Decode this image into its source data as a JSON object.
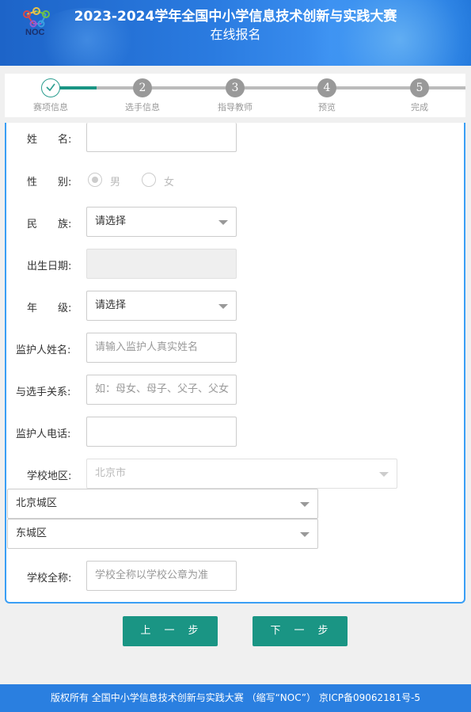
{
  "header": {
    "title_line1": "2023-2024学年全国中小学信息技术创新与实践大赛",
    "title_line2": "在线报名",
    "logo_text": "NOC"
  },
  "steps": [
    {
      "number": "1",
      "label": "赛项信息",
      "state": "done"
    },
    {
      "number": "2",
      "label": "选手信息",
      "state": "pending"
    },
    {
      "number": "3",
      "label": "指导教师",
      "state": "pending"
    },
    {
      "number": "4",
      "label": "预览",
      "state": "pending"
    },
    {
      "number": "5",
      "label": "完成",
      "state": "pending"
    }
  ],
  "form": {
    "name": {
      "label": "姓　　名:",
      "value": ""
    },
    "gender": {
      "label": "性　　别:",
      "options": [
        "男",
        "女"
      ],
      "selected": "男"
    },
    "ethnicity": {
      "label": "民　　族:",
      "value": "请选择"
    },
    "birthdate": {
      "label": "出生日期:",
      "value": ""
    },
    "grade": {
      "label": "年　　级:",
      "value": "请选择"
    },
    "guardian_name": {
      "label": "监护人姓名:",
      "placeholder": "请输入监护人真实姓名"
    },
    "relationship": {
      "label": "与选手关系:",
      "placeholder": "如：母女、母子、父子、父女"
    },
    "guardian_phone": {
      "label": "监护人电话:",
      "value": ""
    },
    "school_region": {
      "label": "学校地区:",
      "province": "北京市",
      "city": "北京城区",
      "district": "东城区"
    },
    "school_name": {
      "label": "学校全称:",
      "placeholder": "学校全称以学校公章为准"
    }
  },
  "buttons": {
    "prev": "上　一　步",
    "next": "下　一　步"
  },
  "footer": {
    "text": "版权所有 全国中小学信息技术创新与实践大赛 （缩写“NOC”） 京ICP备09062181号-5"
  },
  "colors": {
    "header_blue": "#2a7be0",
    "accent_teal": "#1a9584",
    "panel_border": "#3a9ff5"
  }
}
